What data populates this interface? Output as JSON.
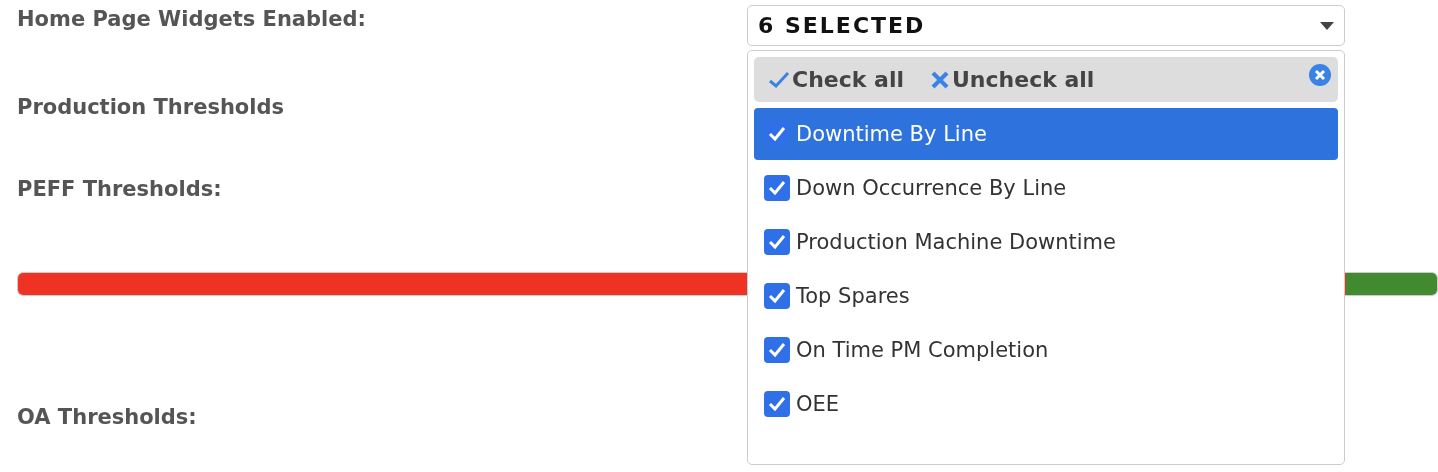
{
  "fields": [
    {
      "kind": "label",
      "text": "Home Page Widgets Enabled:"
    },
    {
      "kind": "heading",
      "text": "Production Thresholds"
    },
    {
      "kind": "label",
      "text": "PEFF Thresholds:"
    },
    {
      "kind": "slider",
      "segments": [
        {
          "color": "#ee3224"
        },
        {
          "color": "#428a30"
        }
      ]
    },
    {
      "kind": "label",
      "text": "OA Thresholds:"
    }
  ],
  "select": {
    "value": "6 SELECTED",
    "check_all": "Check all",
    "uncheck_all": "Uncheck all",
    "options": [
      {
        "label": "Downtime By Line",
        "checked": true,
        "selected": true
      },
      {
        "label": "Down Occurrence By Line",
        "checked": true,
        "selected": false
      },
      {
        "label": "Production Machine Downtime",
        "checked": true,
        "selected": false
      },
      {
        "label": "Top Spares",
        "checked": true,
        "selected": false
      },
      {
        "label": "On Time PM Completion",
        "checked": true,
        "selected": false
      },
      {
        "label": "OEE",
        "checked": true,
        "selected": false
      }
    ]
  }
}
